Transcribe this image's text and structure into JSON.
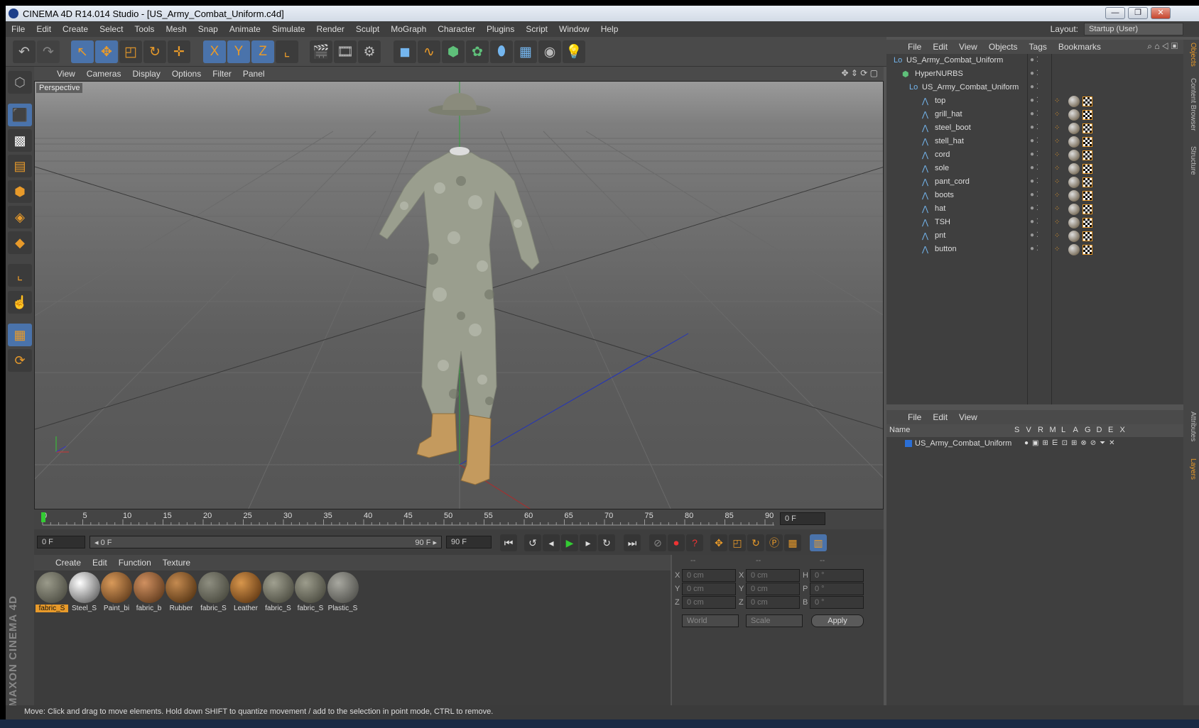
{
  "window": {
    "title": "CINEMA 4D R14.014 Studio - [US_Army_Combat_Uniform.c4d]",
    "min": "—",
    "max": "❐",
    "close": "✕"
  },
  "menu": [
    "File",
    "Edit",
    "Create",
    "Select",
    "Tools",
    "Mesh",
    "Snap",
    "Animate",
    "Simulate",
    "Render",
    "Sculpt",
    "MoGraph",
    "Character",
    "Plugins",
    "Script",
    "Window",
    "Help"
  ],
  "layout": {
    "label": "Layout:",
    "value": "Startup (User)"
  },
  "toolbar_icons": [
    "undo-icon",
    "redo-icon",
    "live-selection-icon",
    "move-icon",
    "scale-icon",
    "rotate-icon",
    "axis-icon",
    "x-axis-icon",
    "y-axis-icon",
    "z-axis-icon",
    "coordinate-system-icon",
    "render-view-icon",
    "render-picture-viewer-icon",
    "render-settings-icon",
    "cube-icon",
    "spline-icon",
    "nurbs-icon",
    "array-icon",
    "deformer-icon",
    "floor-icon",
    "camera-icon",
    "light-icon"
  ],
  "toolbar_glyphs": {
    "x": "X",
    "y": "Y",
    "z": "Z"
  },
  "viewport": {
    "menu": [
      "View",
      "Cameras",
      "Display",
      "Options",
      "Filter",
      "Panel"
    ],
    "label": "Perspective"
  },
  "timeline": {
    "ticks": [
      "0",
      "5",
      "10",
      "15",
      "20",
      "25",
      "30",
      "35",
      "40",
      "45",
      "50",
      "55",
      "60",
      "65",
      "70",
      "75",
      "80",
      "85",
      "90"
    ],
    "end_field": "0 F"
  },
  "transport": {
    "current": "0 F",
    "range_start": "◂ 0 F",
    "range_end": "90 F ▸",
    "max": "90 F"
  },
  "materials": {
    "menu": [
      "Create",
      "Edit",
      "Function",
      "Texture"
    ],
    "items": [
      "fabric_S",
      "Steel_S",
      "Paint_bi",
      "fabric_b",
      "Rubber",
      "fabric_S",
      "Leather",
      "fabric_S",
      "fabric_S",
      "Plastic_S"
    ]
  },
  "coords": {
    "headers": [
      "--",
      "--",
      "--"
    ],
    "rows": [
      {
        "a": "X",
        "av": "0 cm",
        "b": "X",
        "bv": "0 cm",
        "c": "H",
        "cv": "0 °"
      },
      {
        "a": "Y",
        "av": "0 cm",
        "b": "Y",
        "bv": "0 cm",
        "c": "P",
        "cv": "0 °"
      },
      {
        "a": "Z",
        "av": "0 cm",
        "b": "Z",
        "bv": "0 cm",
        "c": "B",
        "cv": "0 °"
      }
    ],
    "space": "World",
    "mode": "Scale",
    "apply": "Apply"
  },
  "objects": {
    "menu": [
      "File",
      "Edit",
      "View",
      "Objects",
      "Tags",
      "Bookmarks"
    ],
    "tree": [
      {
        "name": "US_Army_Combat_Uniform",
        "indent": 0
      },
      {
        "name": "HyperNURBS",
        "indent": 1
      },
      {
        "name": "US_Army_Combat_Uniform",
        "indent": 2
      },
      {
        "name": "top",
        "indent": 3
      },
      {
        "name": "grill_hat",
        "indent": 3
      },
      {
        "name": "steel_boot",
        "indent": 3
      },
      {
        "name": "stell_hat",
        "indent": 3
      },
      {
        "name": "cord",
        "indent": 3
      },
      {
        "name": "sole",
        "indent": 3
      },
      {
        "name": "pant_cord",
        "indent": 3
      },
      {
        "name": "boots",
        "indent": 3
      },
      {
        "name": "hat",
        "indent": 3
      },
      {
        "name": "TSH",
        "indent": 3
      },
      {
        "name": "pnt",
        "indent": 3
      },
      {
        "name": "button",
        "indent": 3
      }
    ]
  },
  "layers": {
    "menu": [
      "File",
      "Edit",
      "View"
    ],
    "header": {
      "name": "Name",
      "cols": [
        "S",
        "V",
        "R",
        "M",
        "L",
        "A",
        "G",
        "D",
        "E",
        "X"
      ]
    },
    "items": [
      "US_Army_Combat_Uniform"
    ]
  },
  "right_tabs": [
    "Objects",
    "Content Browser",
    "Structure",
    "Attributes",
    "Layers"
  ],
  "brand": "MAXON CINEMA 4D",
  "status": "Move: Click and drag to move elements. Hold down SHIFT to quantize movement / add to the selection in point mode, CTRL to remove.",
  "colors": {
    "accent": "#e89a2a",
    "selection": "#4a73ab",
    "panel": "#3f3f3f"
  }
}
